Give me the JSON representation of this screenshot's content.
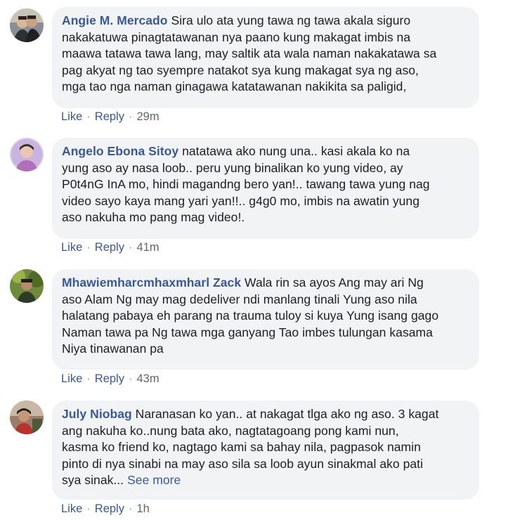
{
  "comments": [
    {
      "author": "Angie M. Mercado",
      "first_line": "Sira ulo ata yung tawa ng tawa akala siguro",
      "lines": [
        "nakakatuwa pinagtatawanan nya paano kung makagat imbis na",
        "maawa tatawa tawa lang, may saltik ata wala naman nakakatawa sa",
        "pag akyat ng tao syempre natakot sya kung makagat sya ng aso,",
        "mga tao nga naman ginagawa katatawanan nakikita sa paligid,"
      ],
      "like": "Like",
      "reply": "Reply",
      "time": "29m"
    },
    {
      "author": "Angelo Ebona Sitoy",
      "first_line": "natatawa ako nung una.. kasi akala ko na",
      "lines": [
        "yung aso ay nasa loob.. peru yung binalikan ko yung video, ay",
        "P0t4nG InA mo, hindi magandng bero yan!.. tawang tawa yung nag",
        "video sayo kaya mang yari yan!!.. g4g0 mo, imbis na awatin yung",
        "aso nakuha mo pang mag video!."
      ],
      "like": "Like",
      "reply": "Reply",
      "time": "41m"
    },
    {
      "author": "Mhawiemharcmhaxmharl Zack",
      "first_line": "Wala rin sa ayos Ang may ari Ng",
      "lines": [
        "aso Alam Ng may mag dedeliver ndi manlang tinali Yung aso nila",
        "halatang pabaya eh parang na trauma tuloy si kuya Yung isang gago",
        "Naman tawa pa Ng tawa mga ganyang Tao imbes tulungan kasama",
        "Niya tinawanan pa"
      ],
      "like": "Like",
      "reply": "Reply",
      "time": "43m"
    },
    {
      "author": "July Niobag",
      "first_line": "Naranasan ko yan.. at nakagat tlga ako ng aso. 3 kagat",
      "lines": [
        "ang nakuha ko..nung bata ako, nagtatagoang pong kami nun,",
        "kasma ko friend ko, nagtago kami sa bahay nila, pagpasok namin",
        "pinto di nya sinabi na may aso sila sa loob ayun sinakmal ako pati",
        "sya sinak..."
      ],
      "see_more": "See more",
      "like": "Like",
      "reply": "Reply",
      "time": "1h"
    }
  ]
}
